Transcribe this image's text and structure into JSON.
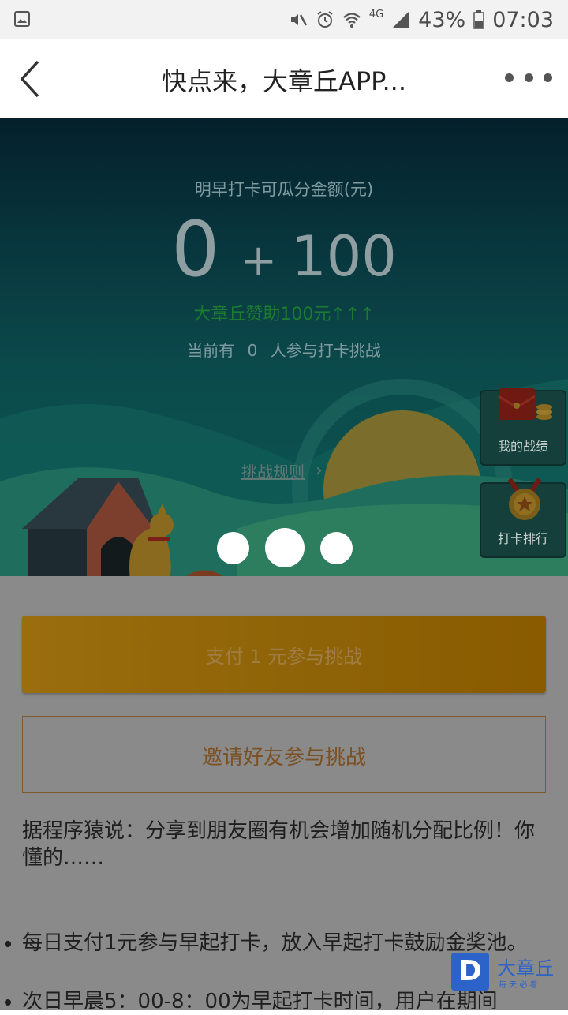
{
  "status_bar": {
    "battery_percent": "43%",
    "time": "07:03",
    "network": "4G"
  },
  "header": {
    "title": "快点来，大章丘APP..."
  },
  "hero": {
    "label": "明早打卡可瓜分金额(元)",
    "amount": "0",
    "plus": "+",
    "bonus_amount": "100",
    "bonus_text": "大章丘赞助100元↑↑↑",
    "participants_prefix": "当前有",
    "participants_count": "0",
    "participants_suffix": "人参与打卡挑战",
    "rules_link": "挑战规则",
    "side_buttons": [
      {
        "label": "我的战绩",
        "icon": "red-envelope-coins-icon"
      },
      {
        "label": "打卡排行",
        "icon": "medal-star-icon"
      }
    ]
  },
  "actions": {
    "pay_label": "支付 1 元参与挑战",
    "invite_label": "邀请好友参与挑战"
  },
  "content": {
    "tip": "据程序猿说：分享到朋友圈有机会增加随机分配比例！你懂的……",
    "rules": [
      "每日支付1元参与早起打卡，放入早起打卡鼓励金奖池。",
      "次日早晨5：00-8：00为早起打卡时间，用户在期间"
    ]
  },
  "watermark": {
    "brand": "大章丘",
    "slogan": "每 天 必 看",
    "letter": "D"
  },
  "colors": {
    "hero_top": "#04202b",
    "hero_bottom": "#0d5753",
    "accent_orange": "#f2a516",
    "bonus_green": "#1d7a30"
  }
}
